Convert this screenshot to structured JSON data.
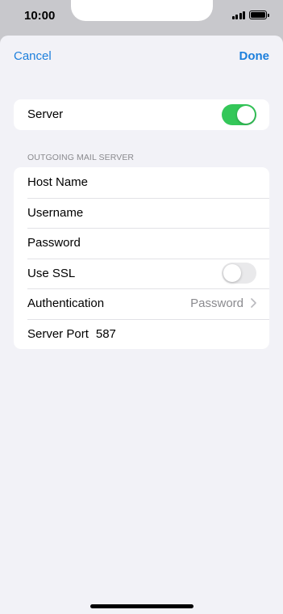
{
  "status_bar": {
    "time": "10:00",
    "signal_icon": "signal-bars-icon",
    "battery_icon": "battery-icon"
  },
  "nav": {
    "cancel_label": "Cancel",
    "done_label": "Done"
  },
  "server_group": {
    "server_label": "Server",
    "server_toggle_on": true
  },
  "outgoing": {
    "section_header": "OUTGOING MAIL SERVER",
    "host_name_placeholder": "Host Name",
    "username_placeholder": "Username",
    "password_placeholder": "Password",
    "use_ssl_label": "Use SSL",
    "use_ssl_on": false,
    "authentication_label": "Authentication",
    "authentication_value": "Password",
    "server_port_label": "Server Port",
    "server_port_value": "587"
  },
  "colors": {
    "accent": "#1c7fdc",
    "toggle_on": "#34c759",
    "background": "#f2f2f7"
  }
}
